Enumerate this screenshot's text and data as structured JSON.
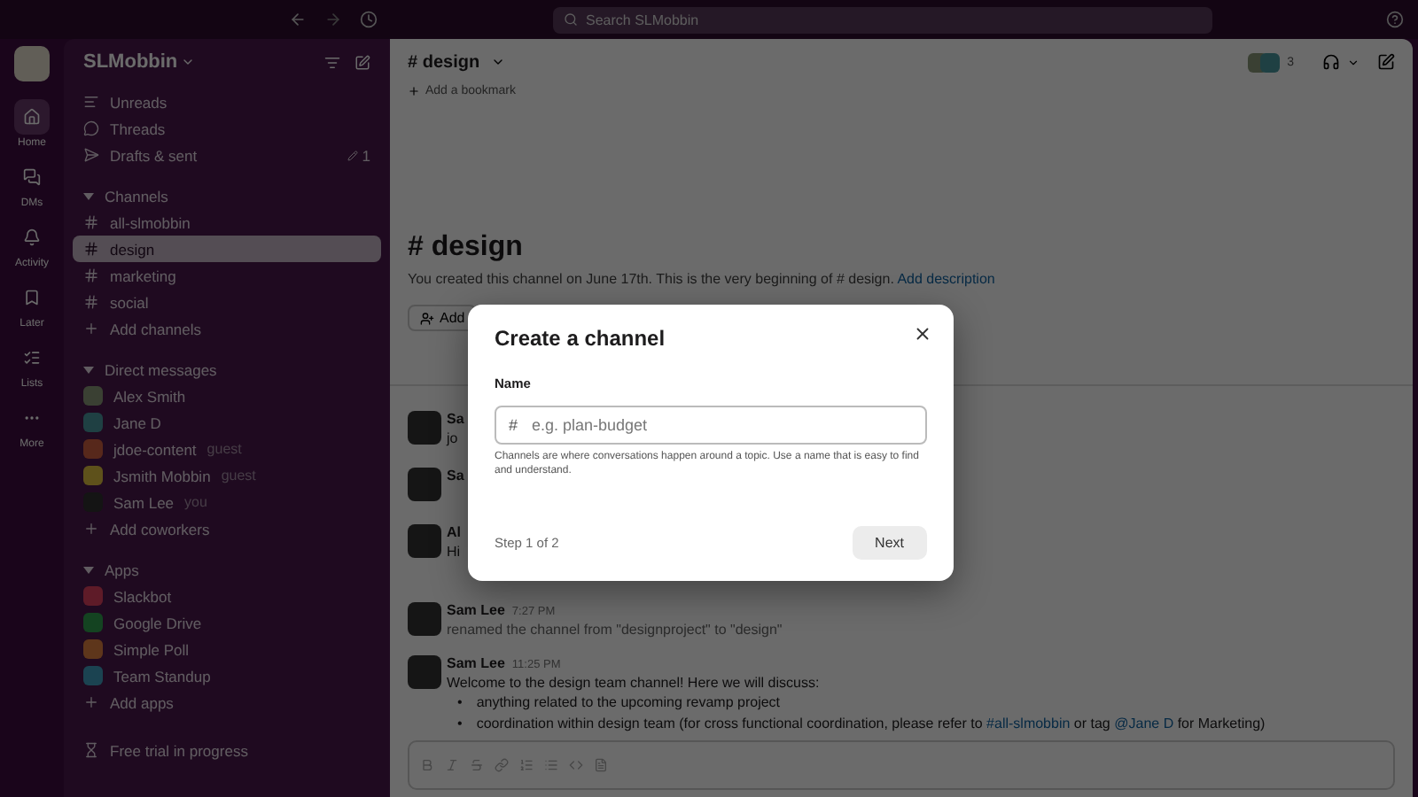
{
  "topbar": {
    "search_placeholder": "Search SLMobbin"
  },
  "rail": [
    {
      "label": "Home",
      "selected": true
    },
    {
      "label": "DMs",
      "selected": false
    },
    {
      "label": "Activity",
      "selected": false
    },
    {
      "label": "Later",
      "selected": false
    },
    {
      "label": "Lists",
      "selected": false
    },
    {
      "label": "More",
      "selected": false
    }
  ],
  "sidebar": {
    "workspace": "SLMobbin",
    "nav": [
      {
        "label": "Unreads"
      },
      {
        "label": "Threads"
      },
      {
        "label": "Drafts & sent",
        "count": "1"
      }
    ],
    "sections": [
      {
        "title": "Channels",
        "expanded": true,
        "items": [
          {
            "kind": "channel",
            "label": "all-slmobbin",
            "selected": false
          },
          {
            "kind": "channel",
            "label": "design",
            "selected": true
          },
          {
            "kind": "channel",
            "label": "marketing",
            "selected": false
          },
          {
            "kind": "channel",
            "label": "social",
            "selected": false
          },
          {
            "kind": "add",
            "label": "Add channels",
            "selected": false
          }
        ]
      },
      {
        "title": "Direct messages",
        "expanded": true,
        "items": [
          {
            "kind": "person",
            "label": "Alex Smith",
            "selected": false
          },
          {
            "kind": "person",
            "label": "Jane D",
            "selected": false
          },
          {
            "kind": "person",
            "label": "jdoe-content",
            "tag": "guest",
            "selected": false
          },
          {
            "kind": "person",
            "label": "Jsmith Mobbin",
            "tag": "guest",
            "selected": false
          },
          {
            "kind": "person",
            "label": "Sam Lee",
            "tag": "you",
            "selected": false
          },
          {
            "kind": "add",
            "label": "Add coworkers",
            "selected": false
          }
        ]
      },
      {
        "title": "Apps",
        "expanded": true,
        "items": [
          {
            "kind": "app",
            "label": "Slackbot",
            "selected": false
          },
          {
            "kind": "app",
            "label": "Google Drive",
            "selected": false
          },
          {
            "kind": "app",
            "label": "Simple Poll",
            "selected": false
          },
          {
            "kind": "app",
            "label": "Team Standup",
            "selected": false
          },
          {
            "kind": "add",
            "label": "Add apps",
            "selected": false
          }
        ]
      }
    ],
    "footer": "Free trial in progress"
  },
  "channel": {
    "title": "# design",
    "member_count": "3",
    "bookmark": "Add a bookmark",
    "intro_title": "# design",
    "intro_text": "You created this channel on June 17th. This is the very beginning of # design.",
    "intro_link": "Add description",
    "add_button": "Add"
  },
  "hidden_messages": [
    {
      "name": "Sa",
      "text": "jo"
    },
    {
      "name": "Sa"
    },
    {
      "name": "Al",
      "text": "Hi"
    }
  ],
  "messages": [
    {
      "name": "Sam Lee",
      "time": "7:27 PM",
      "text": "renamed the channel from \"designproject\" to \"design\"",
      "system": true
    },
    {
      "name": "Sam Lee",
      "time": "11:25 PM",
      "text": "Welcome to the design team channel! Here we will discuss:",
      "system": false,
      "bullets": [
        {
          "marker": "•",
          "text": "anything related to the upcoming revamp project"
        },
        {
          "marker": "•",
          "text": "coordination within design team (for cross functional coordination, please refer to",
          "channel": "#all-slmobbin",
          "mid": "or tag",
          "mention": "@Jane D",
          "end": "for Marketing)"
        }
      ]
    }
  ],
  "modal": {
    "title": "Create a channel",
    "field_label": "Name",
    "prefix": "#",
    "placeholder": "e.g. plan-budget",
    "hint": "Channels are where conversations happen around a topic. Use a name that is easy to find and understand.",
    "step": "Step 1 of 2",
    "next": "Next"
  }
}
